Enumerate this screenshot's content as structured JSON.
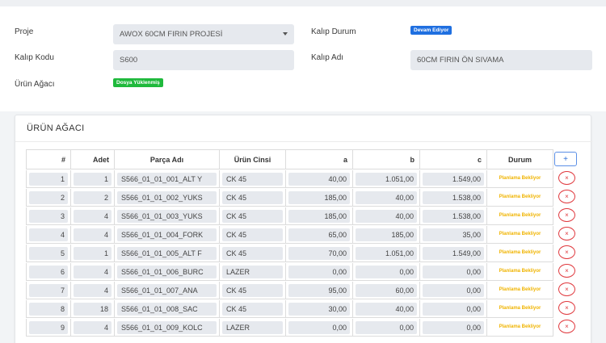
{
  "form": {
    "proje_label": "Proje",
    "proje_value": "AWOX 60CM FIRIN PROJESİ",
    "kalip_durum_label": "Kalıp Durum",
    "kalip_durum_badge": "Devam Ediyor",
    "kalip_kodu_label": "Kalıp Kodu",
    "kalip_kodu_value": "S600",
    "kalip_adi_label": "Kalıp Adı",
    "kalip_adi_value": "60CM FIRIN ÖN SIVAMA",
    "urun_agaci_label": "Ürün Ağacı",
    "urun_agaci_badge": "Dosya Yüklenmiş"
  },
  "card": {
    "title": "ÜRÜN AĞACI",
    "add_button": "+"
  },
  "table": {
    "headers": [
      "#",
      "Adet",
      "Parça Adı",
      "Ürün Cinsi",
      "a",
      "b",
      "c",
      "Durum"
    ],
    "rows": [
      {
        "no": "1",
        "adet": "1",
        "parca": "S566_01_01_001_ALT Y",
        "cins": "CK 45",
        "a": "40,00",
        "b": "1.051,00",
        "c": "1.549,00",
        "durum": "Planlama Bekliyor"
      },
      {
        "no": "2",
        "adet": "2",
        "parca": "S566_01_01_002_YUKS",
        "cins": "CK 45",
        "a": "185,00",
        "b": "40,00",
        "c": "1.538,00",
        "durum": "Planlama Bekliyor"
      },
      {
        "no": "3",
        "adet": "4",
        "parca": "S566_01_01_003_YUKS",
        "cins": "CK 45",
        "a": "185,00",
        "b": "40,00",
        "c": "1.538,00",
        "durum": "Planlama Bekliyor"
      },
      {
        "no": "4",
        "adet": "4",
        "parca": "S566_01_01_004_FORK",
        "cins": "CK 45",
        "a": "65,00",
        "b": "185,00",
        "c": "35,00",
        "durum": "Planlama Bekliyor"
      },
      {
        "no": "5",
        "adet": "1",
        "parca": "S566_01_01_005_ALT F",
        "cins": "CK 45",
        "a": "70,00",
        "b": "1.051,00",
        "c": "1.549,00",
        "durum": "Planlama Bekliyor"
      },
      {
        "no": "6",
        "adet": "4",
        "parca": "S566_01_01_006_BURC",
        "cins": "LAZER",
        "a": "0,00",
        "b": "0,00",
        "c": "0,00",
        "durum": "Planlama Bekliyor"
      },
      {
        "no": "7",
        "adet": "4",
        "parca": "S566_01_01_007_ANA",
        "cins": "CK 45",
        "a": "95,00",
        "b": "60,00",
        "c": "0,00",
        "durum": "Planlama Bekliyor"
      },
      {
        "no": "8",
        "adet": "18",
        "parca": "S566_01_01_008_SAC",
        "cins": "CK 45",
        "a": "30,00",
        "b": "40,00",
        "c": "0,00",
        "durum": "Planlama Bekliyor"
      },
      {
        "no": "9",
        "adet": "4",
        "parca": "S566_01_01_009_KOLC",
        "cins": "LAZER",
        "a": "0,00",
        "b": "0,00",
        "c": "0,00",
        "durum": "Planlama Bekliyor"
      }
    ],
    "delete_label": "×"
  },
  "colors": {
    "accent_blue": "#1f6fe0",
    "success_green": "#1fb93c",
    "status_yellow": "#f0b400",
    "danger_red": "#e0393e"
  }
}
